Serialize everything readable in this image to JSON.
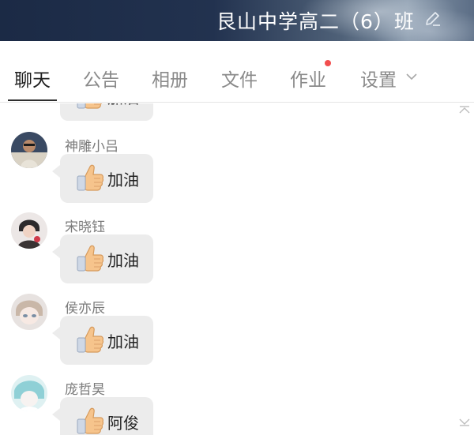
{
  "header": {
    "title": "艮山中学高二（6）班",
    "icon": "edit-icon"
  },
  "tabs": [
    {
      "label": "聊天",
      "active": true
    },
    {
      "label": "公告",
      "active": false
    },
    {
      "label": "相册",
      "active": false
    },
    {
      "label": "文件",
      "active": false
    },
    {
      "label": "作业",
      "active": false,
      "badge": true
    },
    {
      "label": "设置",
      "active": false,
      "dropdown": true
    }
  ],
  "chat": {
    "messages": [
      {
        "sender": "",
        "emoji": "thumbs-up-icon",
        "text": "加油"
      },
      {
        "sender": "神雕小吕",
        "emoji": "thumbs-up-icon",
        "text": "加油"
      },
      {
        "sender": "宋晓钰",
        "emoji": "thumbs-up-icon",
        "text": "加油"
      },
      {
        "sender": "侯亦辰",
        "emoji": "thumbs-up-icon",
        "text": "加油"
      },
      {
        "sender": "庞哲昊",
        "emoji": "thumbs-up-icon",
        "text": "阿俊"
      }
    ]
  },
  "colors": {
    "header_dark": "#1b2a45",
    "bubble_bg": "#ececec",
    "badge": "#f24e4e",
    "active_tab": "#1e1e1e",
    "inactive_tab": "#8a8a8a"
  }
}
